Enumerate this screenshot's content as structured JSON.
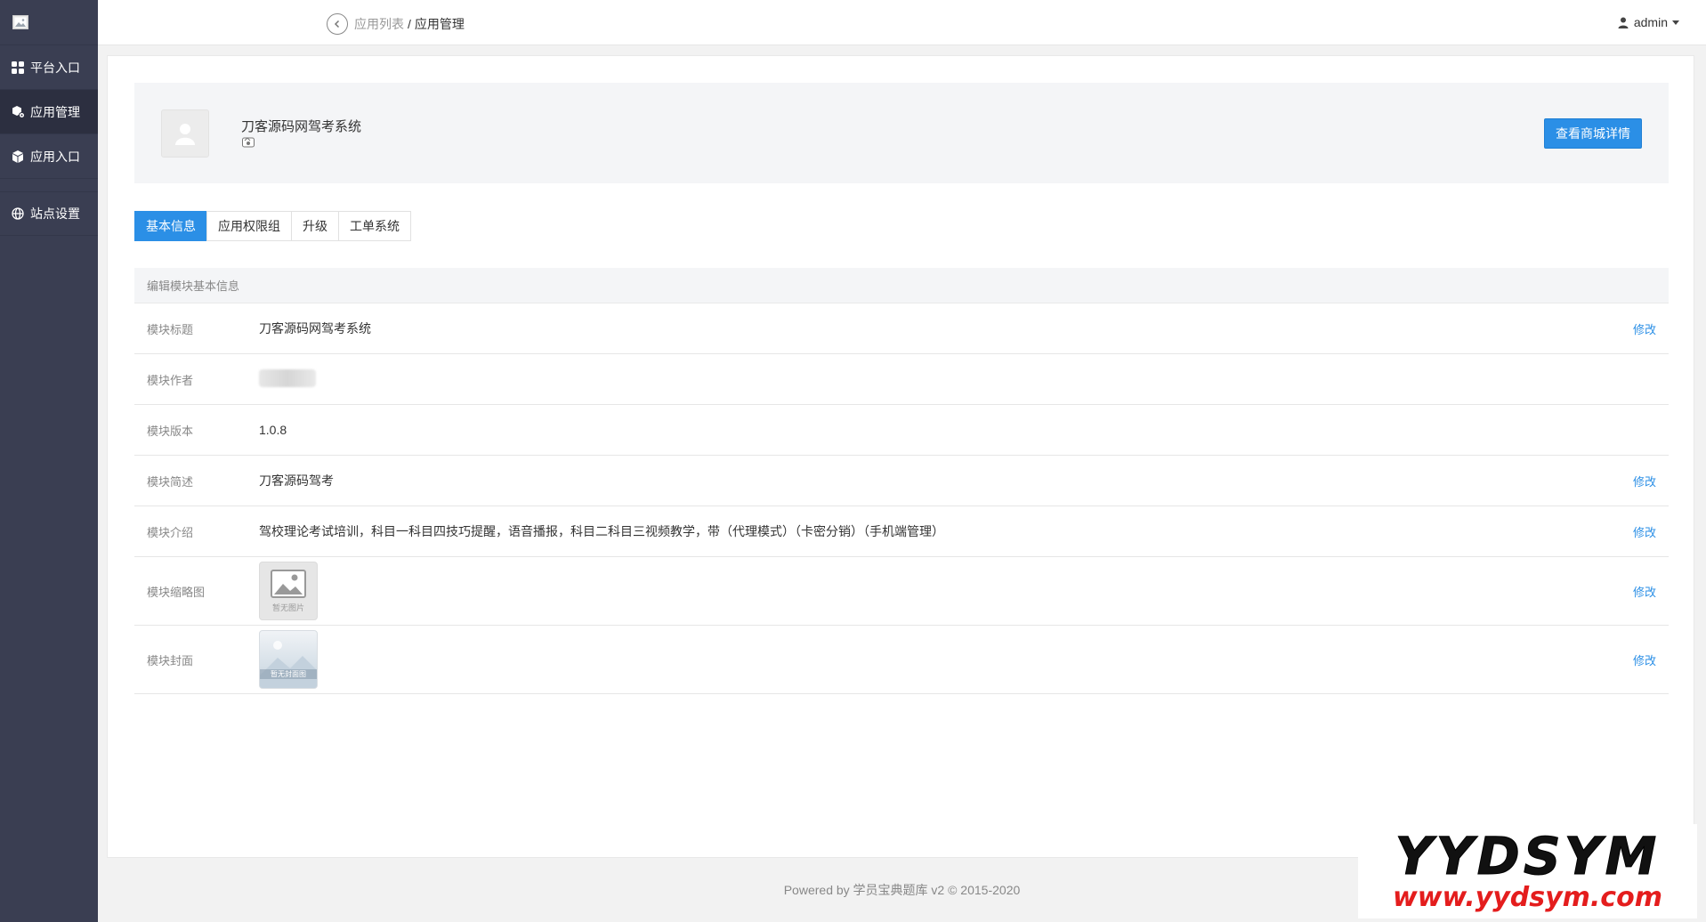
{
  "sidebar": {
    "items": [
      {
        "label": "平台入口",
        "icon": "grid-icon"
      },
      {
        "label": "应用管理",
        "icon": "cube-gear-icon"
      },
      {
        "label": "应用入口",
        "icon": "cube-icon"
      },
      {
        "label": "站点设置",
        "icon": "globe-icon"
      }
    ],
    "active_index": 1
  },
  "topbar": {
    "breadcrumb": {
      "parent": "应用列表",
      "separator": "/",
      "current": "应用管理"
    },
    "user": "admin"
  },
  "app": {
    "name": "刀客源码网驾考系统",
    "shop_button": "查看商城详情"
  },
  "tabs": [
    "基本信息",
    "应用权限组",
    "升级",
    "工单系统"
  ],
  "section": {
    "title": "编辑模块基本信息",
    "rows": [
      {
        "label": "模块标题",
        "value": "刀客源码网驾考系统",
        "edit": "修改"
      },
      {
        "label": "模块作者",
        "value": "",
        "edit": ""
      },
      {
        "label": "模块版本",
        "value": "1.0.8",
        "edit": ""
      },
      {
        "label": "模块简述",
        "value": "刀客源码驾考",
        "edit": "修改"
      },
      {
        "label": "模块介绍",
        "value": "驾校理论考试培训，科目一科目四技巧提醒，语音播报，科目二科目三视频教学，带（代理模式）（卡密分销）（手机端管理）",
        "edit": "修改"
      },
      {
        "label": "模块缩略图",
        "thumb_caption": "暂无图片",
        "edit": "修改"
      },
      {
        "label": "模块封面",
        "cover_caption": "暂无封面图",
        "edit": "修改"
      }
    ]
  },
  "footer": "Powered by 学员宝典题库 v2 © 2015-2020",
  "watermark": {
    "logo": "YYDSYM",
    "url": "www.yydsym.com"
  },
  "colors": {
    "sidebar": "#3a3e52",
    "accent": "#2b8fe6",
    "watermark_url": "#e41d1d"
  }
}
